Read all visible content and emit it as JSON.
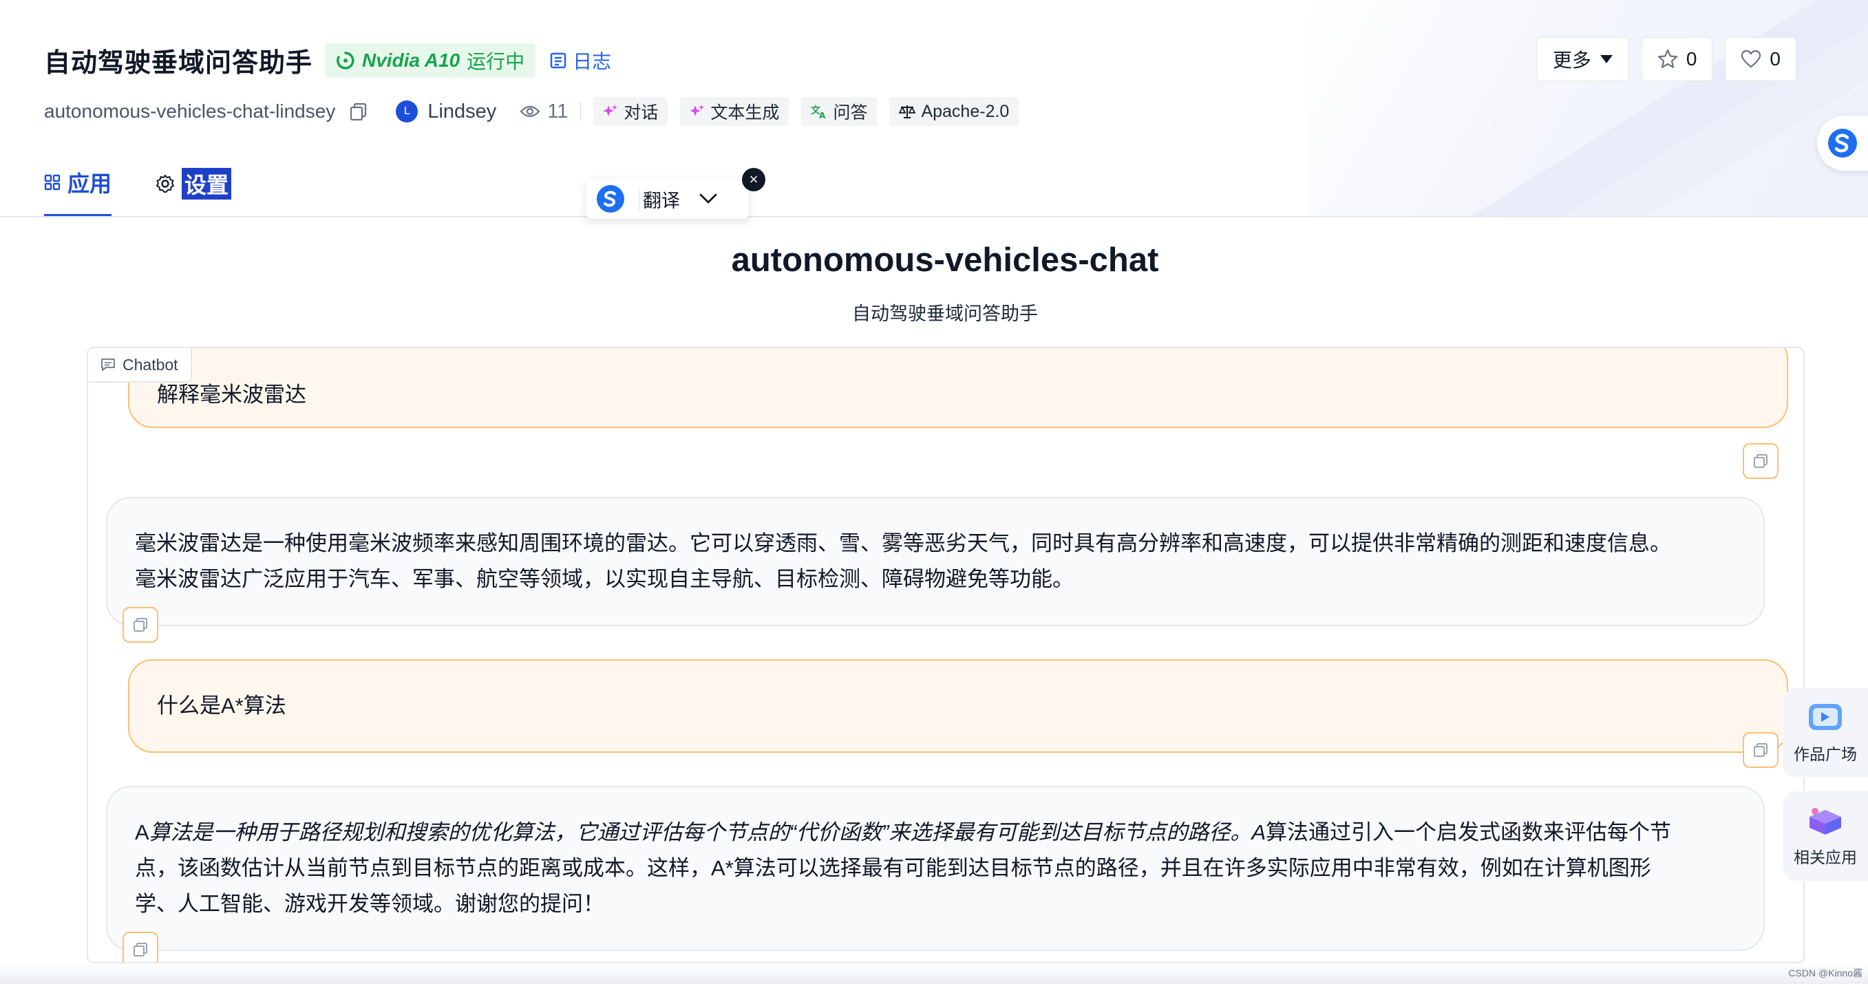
{
  "header": {
    "app_title": "自动驾驶垂域问答助手",
    "gpu_name": "Nvidia A10",
    "status": "运行中",
    "log_label": "日志",
    "repo_slug": "autonomous-vehicles-chat-lindsey",
    "author_initial": "L",
    "author": "Lindsey",
    "views": "11",
    "tags": [
      "对话",
      "文本生成",
      "问答",
      "Apache-2.0"
    ],
    "more_label": "更多",
    "star_count": "0",
    "like_count": "0"
  },
  "tabs": {
    "app": "应用",
    "settings": "设置"
  },
  "translate": {
    "label": "翻译",
    "close": "×"
  },
  "app": {
    "title": "autonomous-vehicles-chat",
    "subtitle": "自动驾驶垂域问答助手",
    "chat_label": "Chatbot"
  },
  "messages": [
    {
      "role": "user",
      "text": "解释毫米波雷达"
    },
    {
      "role": "bot",
      "lines": [
        "毫米波雷达是一种使用毫米波频率来感知周围环境的雷达。它可以穿透雨、雪、雾等恶劣天气，同时具有高分辨率和高速度，可以提供非常精确的测距和速度信息。",
        "毫米波雷达广泛应用于汽车、军事、航空等领域，以实现自主导航、目标检测、障碍物避免等功能。"
      ]
    },
    {
      "role": "user",
      "text": "什么是A*算法"
    },
    {
      "role": "bot",
      "prefix": "A",
      "italic": "算法是一种用于路径规划和搜索的优化算法，它通过评估每个节点的“代价函数”来选择最有可能到达目标节点的路径。A",
      "rest1": "算法通过引入一个启发式函数来评估每个节",
      "line2": "点，该函数估计从当前节点到目标节点的距离或成本。这样，A*算法可以选择最有可能到达目标节点的路径，并且在许多实际应用中非常有效，例如在计算机图形",
      "line3": "学、人工智能、游戏开发等领域。谢谢您的提问！"
    }
  ],
  "side": {
    "works": "作品广场",
    "related": "相关应用"
  },
  "footer": {
    "credit": "CSDN @Kinno酱"
  },
  "colors": {
    "accent": "#1d4ed8",
    "running": "#16a34a",
    "user_bubble": "#fff7ed",
    "user_border": "#fbbf73",
    "bot_bubble": "#f9fafb"
  }
}
